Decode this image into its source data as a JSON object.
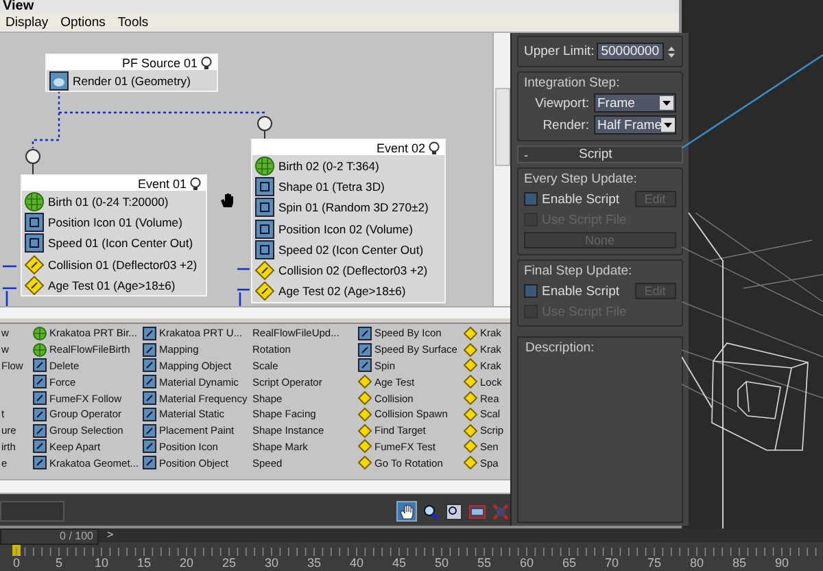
{
  "window": {
    "title": "View"
  },
  "menu": [
    "Display",
    "Options",
    "Tools"
  ],
  "graph": {
    "nodes": [
      {
        "title": "PF Source 01",
        "items": [
          {
            "label": "Render 01 (Geometry)",
            "kind": "render"
          }
        ]
      },
      {
        "title": "Event 01",
        "items": [
          {
            "label": "Birth 01 (0-24 T:20000)",
            "kind": "birth"
          },
          {
            "label": "Position Icon 01 (Volume)",
            "kind": "operator"
          },
          {
            "label": "Speed 01 (Icon Center Out)",
            "kind": "operator"
          },
          {
            "label": "Collision 01 (Deflector03 +2)",
            "kind": "test"
          },
          {
            "label": "Age Test 01 (Age>18±6)",
            "kind": "test"
          }
        ]
      },
      {
        "title": "Event 02",
        "items": [
          {
            "label": "Birth 02 (0-2 T:364)",
            "kind": "birth"
          },
          {
            "label": "Shape 01 (Tetra 3D)",
            "kind": "operator"
          },
          {
            "label": "Spin 01 (Random 3D 270±2)",
            "kind": "operator"
          },
          {
            "label": "Position Icon 02 (Volume)",
            "kind": "operator"
          },
          {
            "label": "Speed 02 (Icon Center Out)",
            "kind": "operator"
          },
          {
            "label": "Collision 02 (Deflector03 +2)",
            "kind": "test"
          },
          {
            "label": "Age Test 02 (Age>18±6)",
            "kind": "test"
          }
        ]
      }
    ]
  },
  "depot": {
    "columns": [
      [
        {
          "label": "w",
          "kind": "plain"
        },
        {
          "label": "w",
          "kind": "plain"
        },
        {
          "label": "Flow",
          "kind": "plain"
        },
        {
          "kind": "blank"
        },
        {
          "kind": "blank"
        },
        {
          "label": "t",
          "kind": "plain"
        },
        {
          "label": "ure",
          "kind": "plain"
        },
        {
          "label": "irth",
          "kind": "plain"
        },
        {
          "label": "e",
          "kind": "plain"
        }
      ],
      [
        {
          "label": "Krakatoa PRT Bir...",
          "kind": "birth"
        },
        {
          "label": "RealFlowFileBirth",
          "kind": "birth"
        },
        {
          "label": "Delete",
          "kind": "operator"
        },
        {
          "label": "Force",
          "kind": "operator"
        },
        {
          "label": "FumeFX Follow",
          "kind": "operator"
        },
        {
          "label": "Group Operator",
          "kind": "operator"
        },
        {
          "label": "Group Selection",
          "kind": "operator"
        },
        {
          "label": "Keep Apart",
          "kind": "operator"
        },
        {
          "label": "Krakatoa Geomet...",
          "kind": "operator"
        }
      ],
      [
        {
          "label": "Krakatoa PRT U...",
          "kind": "operator"
        },
        {
          "label": "Mapping",
          "kind": "operator"
        },
        {
          "label": "Mapping Object",
          "kind": "operator"
        },
        {
          "label": "Material Dynamic",
          "kind": "operator"
        },
        {
          "label": "Material Frequency",
          "kind": "operator"
        },
        {
          "label": "Material Static",
          "kind": "operator"
        },
        {
          "label": "Placement Paint",
          "kind": "operator"
        },
        {
          "label": "Position Icon",
          "kind": "operator"
        },
        {
          "label": "Position Object",
          "kind": "operator"
        }
      ],
      [
        {
          "label": "RealFlowFileUpd...",
          "kind": "plain"
        },
        {
          "label": "Rotation",
          "kind": "plain"
        },
        {
          "label": "Scale",
          "kind": "plain"
        },
        {
          "label": "Script Operator",
          "kind": "plain"
        },
        {
          "label": "Shape",
          "kind": "plain"
        },
        {
          "label": "Shape Facing",
          "kind": "plain"
        },
        {
          "label": "Shape Instance",
          "kind": "plain"
        },
        {
          "label": "Shape Mark",
          "kind": "plain"
        },
        {
          "label": "Speed",
          "kind": "plain"
        }
      ],
      [
        {
          "label": "Speed By Icon",
          "kind": "operator"
        },
        {
          "label": "Speed By Surface",
          "kind": "operator"
        },
        {
          "label": "Spin",
          "kind": "operator"
        },
        {
          "label": "Age Test",
          "kind": "test"
        },
        {
          "label": "Collision",
          "kind": "test"
        },
        {
          "label": "Collision Spawn",
          "kind": "test"
        },
        {
          "label": "Find Target",
          "kind": "test"
        },
        {
          "label": "FumeFX Test",
          "kind": "test"
        },
        {
          "label": "Go To Rotation",
          "kind": "test"
        }
      ],
      [
        {
          "label": "Krak",
          "kind": "test"
        },
        {
          "label": "Krak",
          "kind": "test"
        },
        {
          "label": "Krak",
          "kind": "test"
        },
        {
          "label": "Lock",
          "kind": "test"
        },
        {
          "label": "Rea",
          "kind": "test"
        },
        {
          "label": "Scal",
          "kind": "test"
        },
        {
          "label": "Scrip",
          "kind": "test"
        },
        {
          "label": "Sen",
          "kind": "test"
        },
        {
          "label": "Spa",
          "kind": "test"
        }
      ]
    ]
  },
  "panel": {
    "upper_limit": {
      "label": "Upper Limit:",
      "value": "50000000"
    },
    "integration_step": {
      "title": "Integration Step:",
      "fields": [
        {
          "label": "Viewport:",
          "value": "Frame"
        },
        {
          "label": "Render:",
          "value": "Half Frame"
        }
      ]
    },
    "rollout": {
      "sign": "-",
      "title": "Script"
    },
    "groups": [
      {
        "title": "Every Step Update:",
        "enable": {
          "label": "Enable Script",
          "checked": false,
          "disabled": false
        },
        "edit": {
          "label": "Edit",
          "disabled": true
        },
        "use_file": {
          "label": "Use Script File",
          "checked": false,
          "disabled": true
        },
        "file_button": {
          "label": "None",
          "disabled": true
        }
      },
      {
        "title": "Final Step Update:",
        "enable": {
          "label": "Enable Script",
          "checked": false,
          "disabled": false
        },
        "edit": {
          "label": "Edit",
          "disabled": true
        },
        "use_file": {
          "label": "Use Script File",
          "checked": false,
          "disabled": true
        }
      }
    ],
    "description": {
      "title": "Description:"
    }
  },
  "toolbar": [
    {
      "kind": "pan",
      "selected": true
    },
    {
      "kind": "zoom",
      "selected": false
    },
    {
      "kind": "zoom_region",
      "selected": false
    },
    {
      "kind": "window",
      "selected": false
    },
    {
      "kind": "delete",
      "selected": false
    }
  ],
  "timeline": {
    "slider": "0 / 100",
    "level": 0,
    "arrow": ">",
    "frame_labels": [
      "0",
      "5",
      "10",
      "15",
      "20",
      "25",
      "30",
      "35",
      "40",
      "45",
      "50",
      "55",
      "60",
      "65",
      "70",
      "75",
      "80",
      "85",
      "90"
    ]
  }
}
